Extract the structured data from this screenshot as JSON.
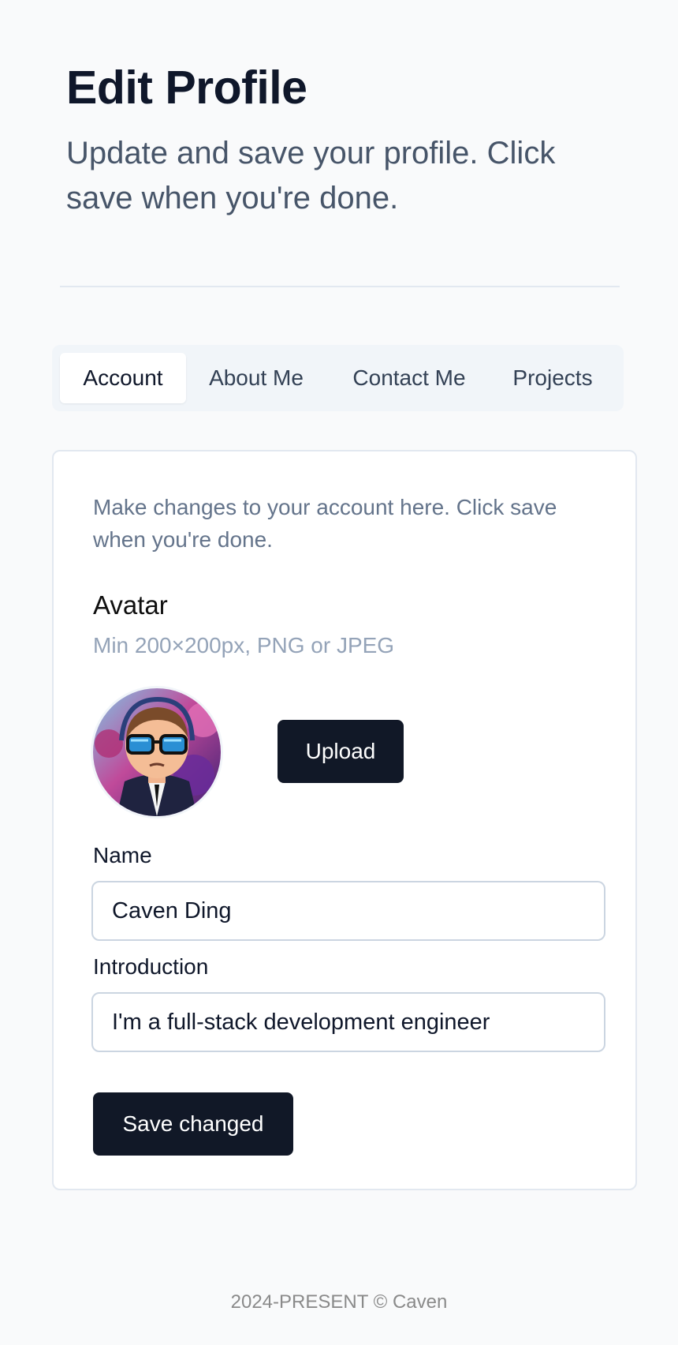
{
  "header": {
    "title": "Edit Profile",
    "subtitle": "Update and save your profile. Click save when you're done."
  },
  "tabs": [
    {
      "label": "Account",
      "active": true
    },
    {
      "label": "About Me",
      "active": false
    },
    {
      "label": "Contact Me",
      "active": false
    },
    {
      "label": "Projects",
      "active": false
    }
  ],
  "account": {
    "description": "Make changes to your account here. Click save when you're done.",
    "avatar_label": "Avatar",
    "avatar_hint": "Min 200×200px, PNG or JPEG",
    "upload_label": "Upload",
    "name_label": "Name",
    "name_value": "Caven Ding",
    "intro_label": "Introduction",
    "intro_value": "I'm a full-stack development engineer",
    "save_label": "Save changed"
  },
  "footer": {
    "text": "2024-PRESENT © Caven"
  },
  "colors": {
    "primary_button": "#111827",
    "tab_bar": "#f1f5f9",
    "card_border": "#e2e8f0"
  }
}
